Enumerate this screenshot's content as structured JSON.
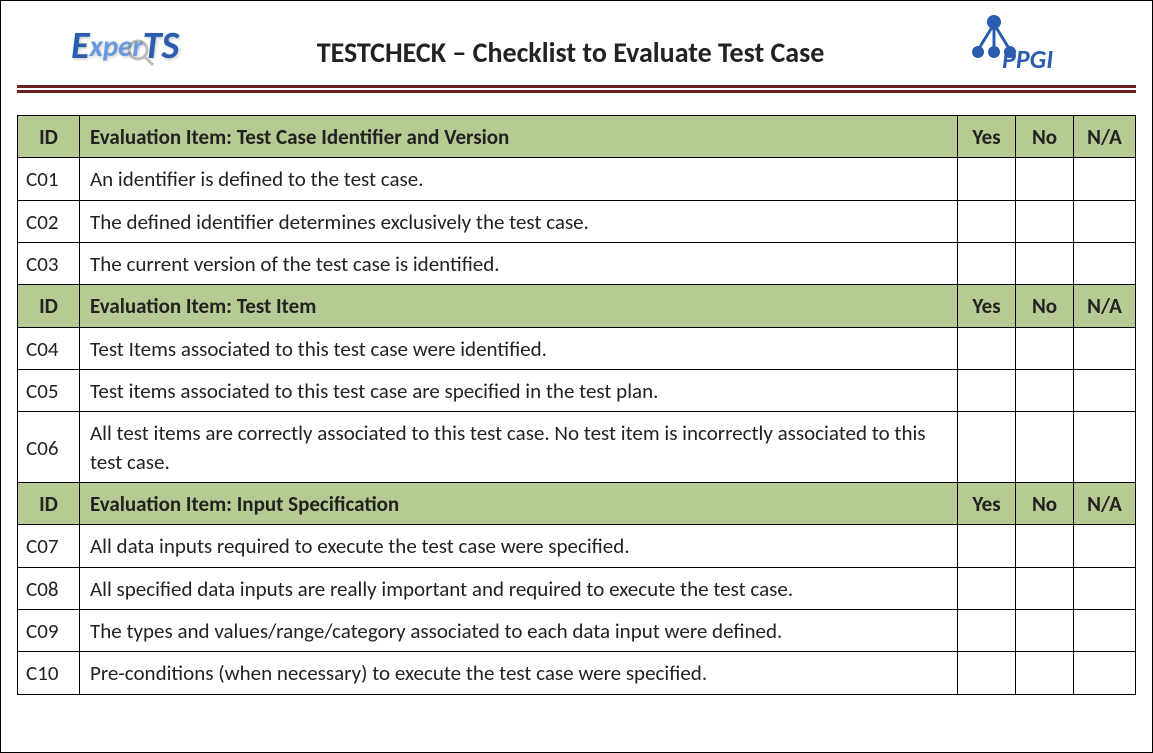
{
  "header": {
    "logo_left": "ExperTS",
    "title": "TESTCHECK – Checklist to Evaluate Test Case",
    "logo_right": "PPGI"
  },
  "columns": {
    "id": "ID",
    "yes": "Yes",
    "no": "No",
    "na": "N/A"
  },
  "sections": [
    {
      "heading": "Evaluation Item: Test Case Identifier and Version",
      "rows": [
        {
          "id": "C01",
          "text": "An identifier is defined to the test case."
        },
        {
          "id": "C02",
          "text": "The defined identifier determines exclusively the test case."
        },
        {
          "id": "C03",
          "text": "The current version of the test case is identified."
        }
      ]
    },
    {
      "heading": "Evaluation Item: Test Item",
      "rows": [
        {
          "id": "C04",
          "text": "Test Items associated to this test case were identified."
        },
        {
          "id": "C05",
          "text": "Test items associated to this test case are specified in the test plan."
        },
        {
          "id": "C06",
          "text": "All test items are correctly associated to this test case. No test item is incorrectly associated to this test case."
        }
      ]
    },
    {
      "heading": "Evaluation Item: Input Specification",
      "rows": [
        {
          "id": "C07",
          "text": "All data inputs required to execute the test case were specified."
        },
        {
          "id": "C08",
          "text": "All specified data inputs are really important and required to execute the test case."
        },
        {
          "id": "C09",
          "text": "The types and values/range/category associated to each data input were defined."
        },
        {
          "id": "C10",
          "text": "Pre-conditions (when necessary) to execute the test case were specified."
        }
      ]
    }
  ]
}
